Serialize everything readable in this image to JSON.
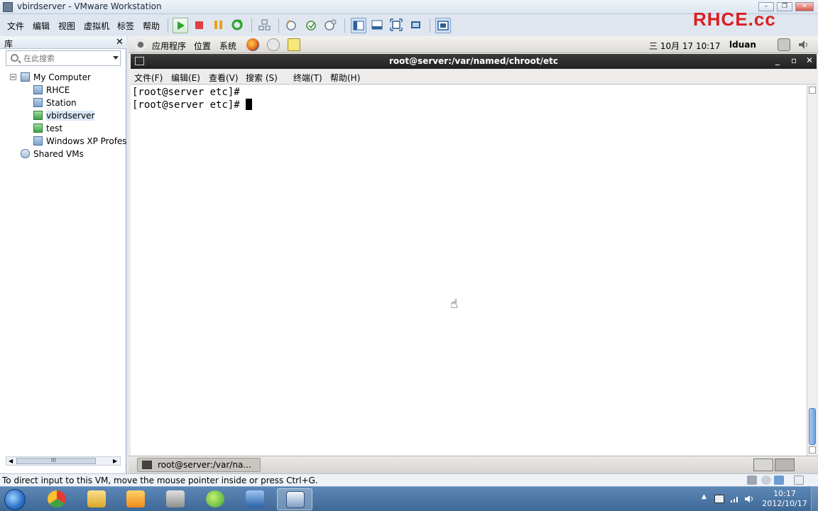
{
  "window": {
    "title": "vbirdserver - VMware Workstation",
    "brand": "RHCE.cc",
    "minimize": "–",
    "maximize": "❐",
    "close": "✕"
  },
  "menu": {
    "items": [
      "文件",
      "编辑",
      "视图",
      "虚拟机",
      "标签",
      "帮助"
    ]
  },
  "toolbar": {
    "play_color": "#2da32d",
    "stop_color": "#e04040",
    "pause_color": "#e8a11a"
  },
  "library": {
    "header": "库",
    "close": "✕",
    "search_placeholder": "在此搜索",
    "tree": {
      "root": "My Computer",
      "items": [
        "RHCE",
        "Station",
        "vbirdserver",
        "test",
        "Windows XP Profess"
      ],
      "shared": "Shared VMs"
    },
    "scroll_grip": "III"
  },
  "guest": {
    "panel": {
      "apps": "应用程序",
      "places": "位置",
      "system": "系统",
      "datetime": "三 10月 17 10:17",
      "user": "lduan"
    },
    "terminal": {
      "title": "root@server:/var/named/chroot/etc",
      "controls": [
        "_",
        "▫",
        "✕"
      ],
      "menu": [
        "文件(F)",
        "编辑(E)",
        "查看(V)",
        "搜索 (S)",
        "终端(T)",
        "帮助(H)"
      ],
      "lines": [
        "[root@server etc]#",
        "[root@server etc]# "
      ]
    },
    "taskbar": {
      "task_label": "root@server:/var/na..."
    }
  },
  "statusbar": {
    "text": "To direct input to this VM, move the mouse pointer inside or press Ctrl+G."
  },
  "wintaskbar": {
    "time": "10:17",
    "date": "2012/10/17",
    "tray_expand": "▲"
  }
}
